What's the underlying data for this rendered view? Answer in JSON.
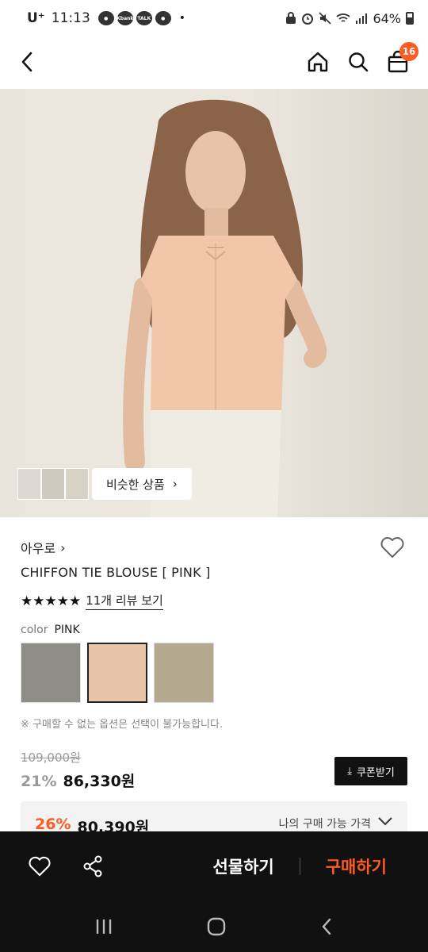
{
  "status_bar": {
    "carrier": "U⁺",
    "time": "11:13",
    "chips": [
      "Kbank",
      "TALK"
    ],
    "battery": "64%"
  },
  "header": {
    "cart_count": "16"
  },
  "hero": {
    "similar_button_label": "비슷한 상품",
    "thumb_colors": [
      "#dcd9d2",
      "#cfcac0",
      "#d8d2c6"
    ]
  },
  "product": {
    "brand": "아우로",
    "name": "CHIFFON TIE BLOUSE [ PINK ]",
    "rating_stars": 5,
    "review_link": "11개 리뷰 보기",
    "color_label": "color",
    "color_value": "PINK",
    "swatch_colors": [
      "#8f8e86",
      "#e7c3a8",
      "#b4a98f"
    ],
    "notice": "※ 구매할 수 없는 옵션은 선택이 불가능합니다.",
    "original_price": "109,000원",
    "discount": "21%",
    "price": "86,330원",
    "coupon_button": "쿠폰받기"
  },
  "best_price": {
    "discount": "26%",
    "price": "80,390원",
    "label": "나의 구매 가능 가격"
  },
  "action_bar": {
    "gift_label": "선물하기",
    "buy_label": "구매하기"
  },
  "colors": {
    "accent": "#ff5a1f",
    "bar_bg": "#111111"
  }
}
